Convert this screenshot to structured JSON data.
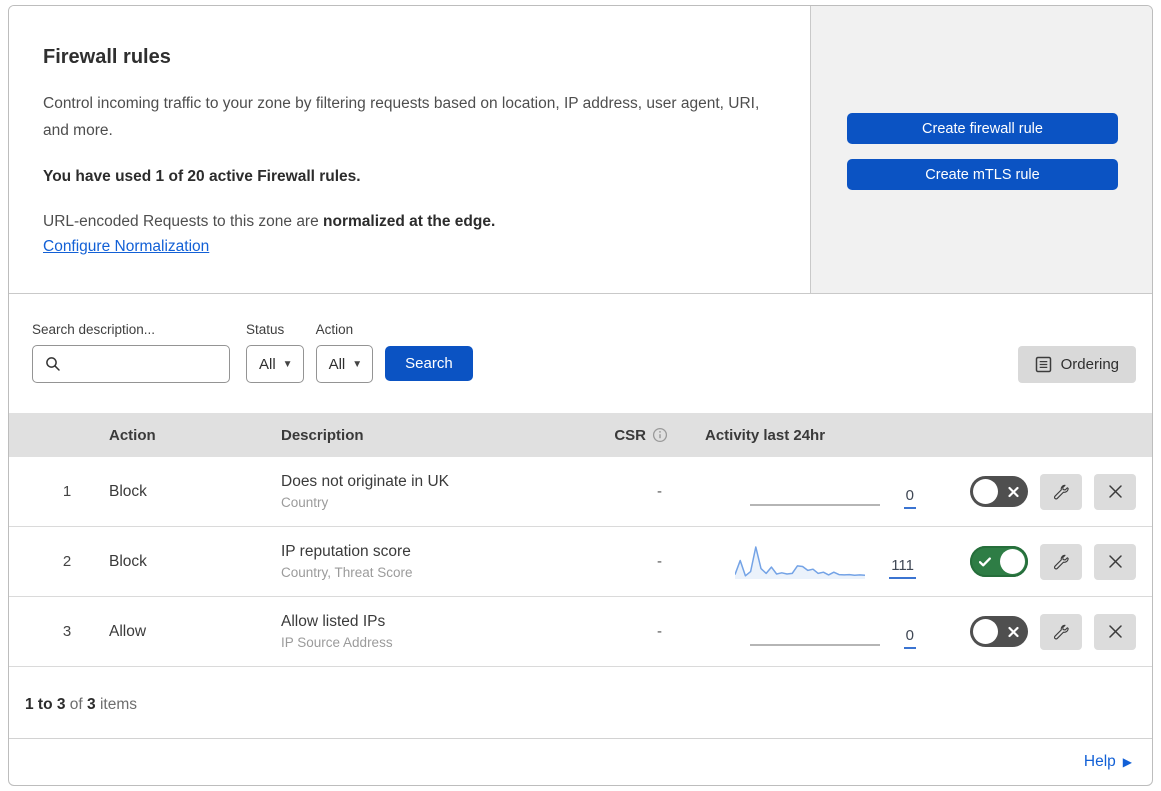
{
  "header": {
    "title": "Firewall rules",
    "description": "Control incoming traffic to your zone by filtering requests based on location, IP address, user agent, URI, and more.",
    "usage": "You have used 1 of 20 active Firewall rules.",
    "normalization_text": "URL-encoded Requests to this zone are ",
    "normalization_bold": "normalized at the edge.",
    "normalization_link": "Configure Normalization",
    "create_firewall_rule": "Create firewall rule",
    "create_mtls_rule": "Create mTLS rule"
  },
  "filters": {
    "search_label": "Search description...",
    "search_value": "",
    "status_label": "Status",
    "status_value": "All",
    "action_label": "Action",
    "action_value": "All",
    "search_button": "Search",
    "ordering_button": "Ordering"
  },
  "table": {
    "headers": {
      "action": "Action",
      "description": "Description",
      "csr": "CSR",
      "activity": "Activity last 24hr"
    },
    "rows": [
      {
        "priority": "1",
        "action": "Block",
        "description": "Does not originate in UK",
        "match_fields": "Country",
        "csr": "-",
        "activity_count": "0",
        "enabled": false,
        "sparkline": []
      },
      {
        "priority": "2",
        "action": "Block",
        "description": "IP reputation score",
        "match_fields": "Country, Threat Score",
        "csr": "-",
        "activity_count": "111",
        "enabled": true,
        "sparkline": [
          8,
          55,
          4,
          18,
          100,
          28,
          12,
          33,
          10,
          14,
          10,
          12,
          37,
          35,
          22,
          26,
          12,
          16,
          7,
          16,
          8,
          7,
          8,
          6,
          7,
          6
        ]
      },
      {
        "priority": "3",
        "action": "Allow",
        "description": "Allow listed IPs",
        "match_fields": "IP Source Address",
        "csr": "-",
        "activity_count": "0",
        "enabled": false,
        "sparkline": []
      }
    ]
  },
  "footer": {
    "range": "1 to 3",
    "of": "of",
    "total": "3",
    "items": "items"
  },
  "help_label": "Help",
  "colors": {
    "primary_blue": "#0b53c3",
    "link_blue": "#1260d6",
    "toggle_on_green": "#2e7d45",
    "toggle_off_gray": "#4f4f4f",
    "sparkline_blue": "#74a3e6",
    "table_header_gray": "#e0e0e0",
    "side_panel_gray": "#f1f1f1"
  }
}
